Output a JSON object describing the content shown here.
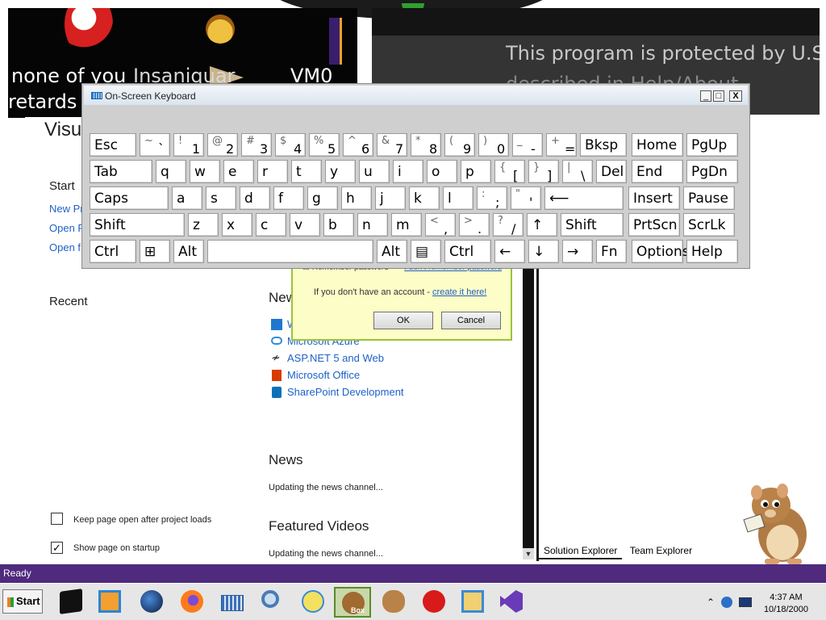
{
  "banner": {
    "left_caption_line1": "none of you",
    "left_caption_mid": "Insaniquar",
    "left_caption_right": "VM0",
    "left_caption_line2": "retards k",
    "right_caption_line1": "This program is protected by U.S. and",
    "right_caption_line2": "described in Help/About"
  },
  "start_page": {
    "title": "Visu",
    "start_heading": "Start",
    "start_links": [
      "New Pr",
      "Open P",
      "Open f"
    ],
    "recent_heading": "Recent",
    "news_heading_partial": "New",
    "news_links": [
      "W",
      "Microsoft Azure",
      "ASP.NET 5 and Web",
      "Microsoft Office",
      "SharePoint Development"
    ],
    "news_heading": "News",
    "news_status": "Updating the news channel...",
    "videos_heading": "Featured Videos",
    "videos_status": "Updating the news channel...",
    "keep_open_label": "Keep page open after project loads",
    "keep_open_checked": false,
    "show_startup_label": "Show page on startup",
    "show_startup_checked": true
  },
  "right_panel": {
    "tabs": [
      "Solution Explorer",
      "Team Explorer"
    ]
  },
  "status_bar": {
    "text": "Ready"
  },
  "login_dialog": {
    "remember_label": "Remember password",
    "forgot_link": "I don't remember password",
    "no_account_text": "If you don't have an account -",
    "create_link": "create it here!",
    "ok_label": "OK",
    "cancel_label": "Cancel"
  },
  "osk": {
    "title": "On-Screen Keyboard",
    "min_glyph": "_",
    "max_glyph": "□",
    "close_glyph": "X",
    "rows": [
      [
        {
          "name": "esc",
          "main": "Esc"
        },
        {
          "name": "tilde",
          "shift": "~",
          "base": "`"
        },
        {
          "name": "1",
          "shift": "!",
          "base": "1"
        },
        {
          "name": "2",
          "shift": "@",
          "base": "2"
        },
        {
          "name": "3",
          "shift": "#",
          "base": "3"
        },
        {
          "name": "4",
          "shift": "$",
          "base": "4"
        },
        {
          "name": "5",
          "shift": "%",
          "base": "5"
        },
        {
          "name": "6",
          "shift": "^",
          "base": "6"
        },
        {
          "name": "7",
          "shift": "&",
          "base": "7"
        },
        {
          "name": "8",
          "shift": "*",
          "base": "8"
        },
        {
          "name": "9",
          "shift": "(",
          "base": "9"
        },
        {
          "name": "0",
          "shift": ")",
          "base": "0"
        },
        {
          "name": "minus",
          "shift": "_",
          "base": "-"
        },
        {
          "name": "equals",
          "shift": "+",
          "base": "="
        },
        {
          "name": "bksp",
          "main": "Bksp"
        },
        {
          "name": "home",
          "main": "Home"
        },
        {
          "name": "pgup",
          "main": "PgUp"
        }
      ],
      [
        {
          "name": "tab",
          "main": "Tab"
        },
        {
          "name": "q",
          "main": "q"
        },
        {
          "name": "w",
          "main": "w"
        },
        {
          "name": "e",
          "main": "e"
        },
        {
          "name": "r",
          "main": "r"
        },
        {
          "name": "t",
          "main": "t"
        },
        {
          "name": "y",
          "main": "y"
        },
        {
          "name": "u",
          "main": "u"
        },
        {
          "name": "i",
          "main": "i"
        },
        {
          "name": "o",
          "main": "o"
        },
        {
          "name": "p",
          "main": "p"
        },
        {
          "name": "lbracket",
          "shift": "{",
          "base": "["
        },
        {
          "name": "rbracket",
          "shift": "}",
          "base": "]"
        },
        {
          "name": "backslash",
          "shift": "|",
          "base": "\\"
        },
        {
          "name": "del",
          "main": "Del"
        },
        {
          "name": "end",
          "main": "End"
        },
        {
          "name": "pgdn",
          "main": "PgDn"
        }
      ],
      [
        {
          "name": "caps",
          "main": "Caps"
        },
        {
          "name": "a",
          "main": "a"
        },
        {
          "name": "s",
          "main": "s"
        },
        {
          "name": "d",
          "main": "d"
        },
        {
          "name": "f",
          "main": "f"
        },
        {
          "name": "g",
          "main": "g"
        },
        {
          "name": "h",
          "main": "h"
        },
        {
          "name": "j",
          "main": "j"
        },
        {
          "name": "k",
          "main": "k"
        },
        {
          "name": "l",
          "main": "l"
        },
        {
          "name": "semicolon",
          "shift": ":",
          "base": ";"
        },
        {
          "name": "quote",
          "shift": "\"",
          "base": "'"
        },
        {
          "name": "enter",
          "main": "⟵"
        },
        {
          "name": "insert",
          "main": "Insert"
        },
        {
          "name": "pause",
          "main": "Pause"
        }
      ],
      [
        {
          "name": "shift-left",
          "main": "Shift"
        },
        {
          "name": "z",
          "main": "z"
        },
        {
          "name": "x",
          "main": "x"
        },
        {
          "name": "c",
          "main": "c"
        },
        {
          "name": "v",
          "main": "v"
        },
        {
          "name": "b",
          "main": "b"
        },
        {
          "name": "n",
          "main": "n"
        },
        {
          "name": "m",
          "main": "m"
        },
        {
          "name": "comma",
          "shift": "<",
          "base": ","
        },
        {
          "name": "period",
          "shift": ">",
          "base": "."
        },
        {
          "name": "slash",
          "shift": "?",
          "base": "/"
        },
        {
          "name": "arrow-up",
          "main": "↑"
        },
        {
          "name": "shift-right",
          "main": "Shift"
        },
        {
          "name": "prtscn",
          "main": "PrtScn"
        },
        {
          "name": "scrlk",
          "main": "ScrLk"
        }
      ],
      [
        {
          "name": "ctrl-left",
          "main": "Ctrl"
        },
        {
          "name": "win",
          "main": "⊞"
        },
        {
          "name": "alt-left",
          "main": "Alt"
        },
        {
          "name": "space",
          "main": ""
        },
        {
          "name": "alt-right",
          "main": "Alt"
        },
        {
          "name": "menu",
          "main": "▤"
        },
        {
          "name": "ctrl-right",
          "main": "Ctrl"
        },
        {
          "name": "arrow-left",
          "main": "←"
        },
        {
          "name": "arrow-down",
          "main": "↓"
        },
        {
          "name": "arrow-right",
          "main": "→"
        },
        {
          "name": "fn",
          "main": "Fn"
        },
        {
          "name": "options",
          "main": "Options"
        },
        {
          "name": "help",
          "main": "Help"
        }
      ]
    ]
  },
  "taskbar": {
    "start_label": "Start",
    "items": [
      "terminal",
      "media",
      "globe",
      "firefox",
      "keyboard",
      "search",
      "messenger",
      "hamster-box",
      "hamster",
      "record",
      "explorer",
      "visual-studio"
    ],
    "box_badge": "Box",
    "clock_time": "4:37 AM",
    "clock_date": "10/18/2000"
  }
}
